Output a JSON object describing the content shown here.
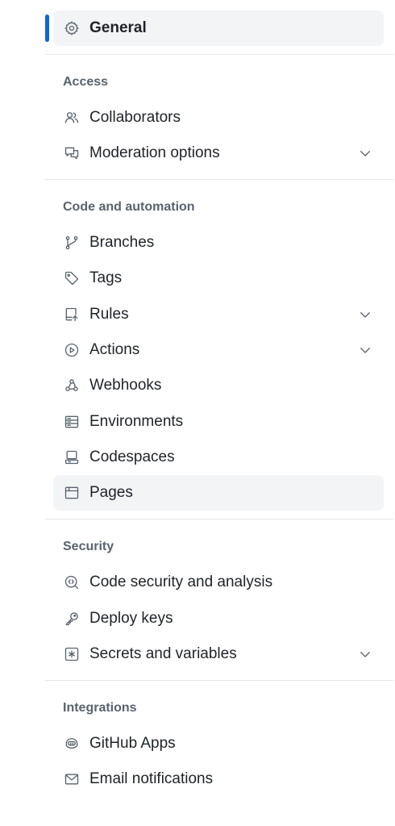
{
  "general": {
    "label": "General",
    "icon": "gear-icon"
  },
  "sections": {
    "access": {
      "title": "Access",
      "items": [
        {
          "label": "Collaborators",
          "icon": "people-icon"
        },
        {
          "label": "Moderation options",
          "icon": "comment-discussion-icon",
          "expandable": true
        }
      ]
    },
    "code": {
      "title": "Code and automation",
      "items": [
        {
          "label": "Branches",
          "icon": "git-branch-icon"
        },
        {
          "label": "Tags",
          "icon": "tag-icon"
        },
        {
          "label": "Rules",
          "icon": "repo-push-icon",
          "expandable": true
        },
        {
          "label": "Actions",
          "icon": "play-icon",
          "expandable": true
        },
        {
          "label": "Webhooks",
          "icon": "webhook-icon"
        },
        {
          "label": "Environments",
          "icon": "server-icon"
        },
        {
          "label": "Codespaces",
          "icon": "codespaces-icon"
        },
        {
          "label": "Pages",
          "icon": "browser-icon",
          "highlighted": true
        }
      ]
    },
    "security": {
      "title": "Security",
      "items": [
        {
          "label": "Code security and analysis",
          "icon": "codescan-icon"
        },
        {
          "label": "Deploy keys",
          "icon": "key-icon"
        },
        {
          "label": "Secrets and variables",
          "icon": "asterisk-icon",
          "expandable": true
        }
      ]
    },
    "integrations": {
      "title": "Integrations",
      "items": [
        {
          "label": "GitHub Apps",
          "icon": "copilot-icon"
        },
        {
          "label": "Email notifications",
          "icon": "mail-icon"
        }
      ]
    }
  },
  "colors": {
    "accent": "#0969da",
    "highlight_bg": "#f3f4f6",
    "muted_text": "#59636e"
  }
}
